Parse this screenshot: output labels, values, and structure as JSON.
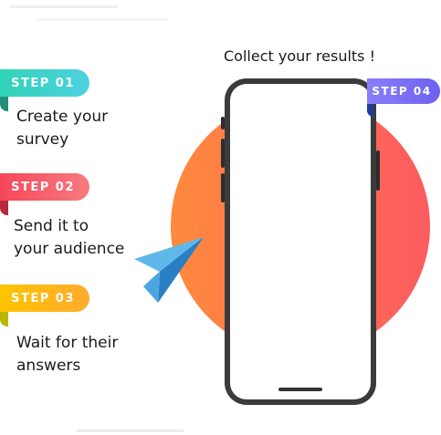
{
  "title": "Collect your results !",
  "steps": [
    {
      "badge": "STEP 01",
      "text_line1": "Create your",
      "text_line2": "survey"
    },
    {
      "badge": "STEP 02",
      "text_line1": "Send it to",
      "text_line2": "your audience"
    },
    {
      "badge": "STEP 03",
      "text_line1": "Wait for their",
      "text_line2": "answers"
    },
    {
      "badge": "STEP 04"
    }
  ],
  "colors": {
    "step01": "#3ed6c4",
    "step02": "#f4535f",
    "step03": "#ffb300",
    "step04": "#7a6ff5",
    "circle": "#ff7a45",
    "phone": "#3b3b3b",
    "plane": "#3a9bdc"
  },
  "icons": {
    "plane": "paper-plane-icon",
    "phone": "smartphone-icon"
  }
}
